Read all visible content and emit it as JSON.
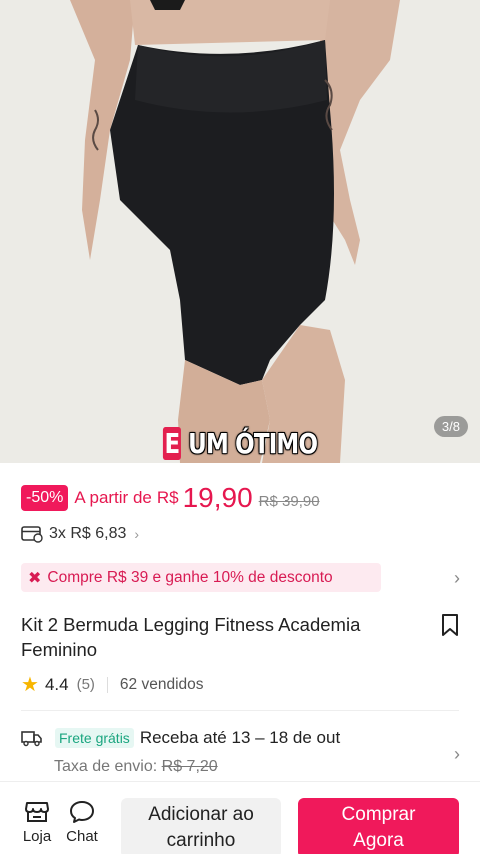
{
  "gallery": {
    "counter": "3/8",
    "caption_highlight": "E",
    "caption_rest": "UM ÓTIMO"
  },
  "price": {
    "discount_badge": "-50%",
    "from_label": "A partir de",
    "currency": "R$",
    "value": "19,90",
    "old_price": "R$ 39,90"
  },
  "installments": {
    "text": "3x R$ 6,83",
    "chevron": "›"
  },
  "promo": {
    "text": "Compre R$ 39 e ganhe 10% de desconto",
    "chevron": "›"
  },
  "product": {
    "title": "Kit 2 Bermuda Legging Fitness  Academia Feminino"
  },
  "rating": {
    "score": "4.4",
    "count": "(5)",
    "sold": "62 vendidos"
  },
  "shipping": {
    "free_badge": "Frete grátis",
    "delivery": "Receba até 13 – 18 de out",
    "fee_label": "Taxa de envio:",
    "fee_old": "R$ 7,20",
    "chevron": "›"
  },
  "bottom_bar": {
    "store_label": "Loja",
    "chat_label": "Chat",
    "add_to_cart_line1": "Adicionar ao",
    "add_to_cart_line2": "carrinho",
    "buy_now_line1": "Comprar",
    "buy_now_line2": "Agora"
  },
  "colors": {
    "accent": "#f0195b",
    "promo_bg": "#fdeaf0",
    "free_shipping": "#1aa57f",
    "star": "#f7b500"
  }
}
